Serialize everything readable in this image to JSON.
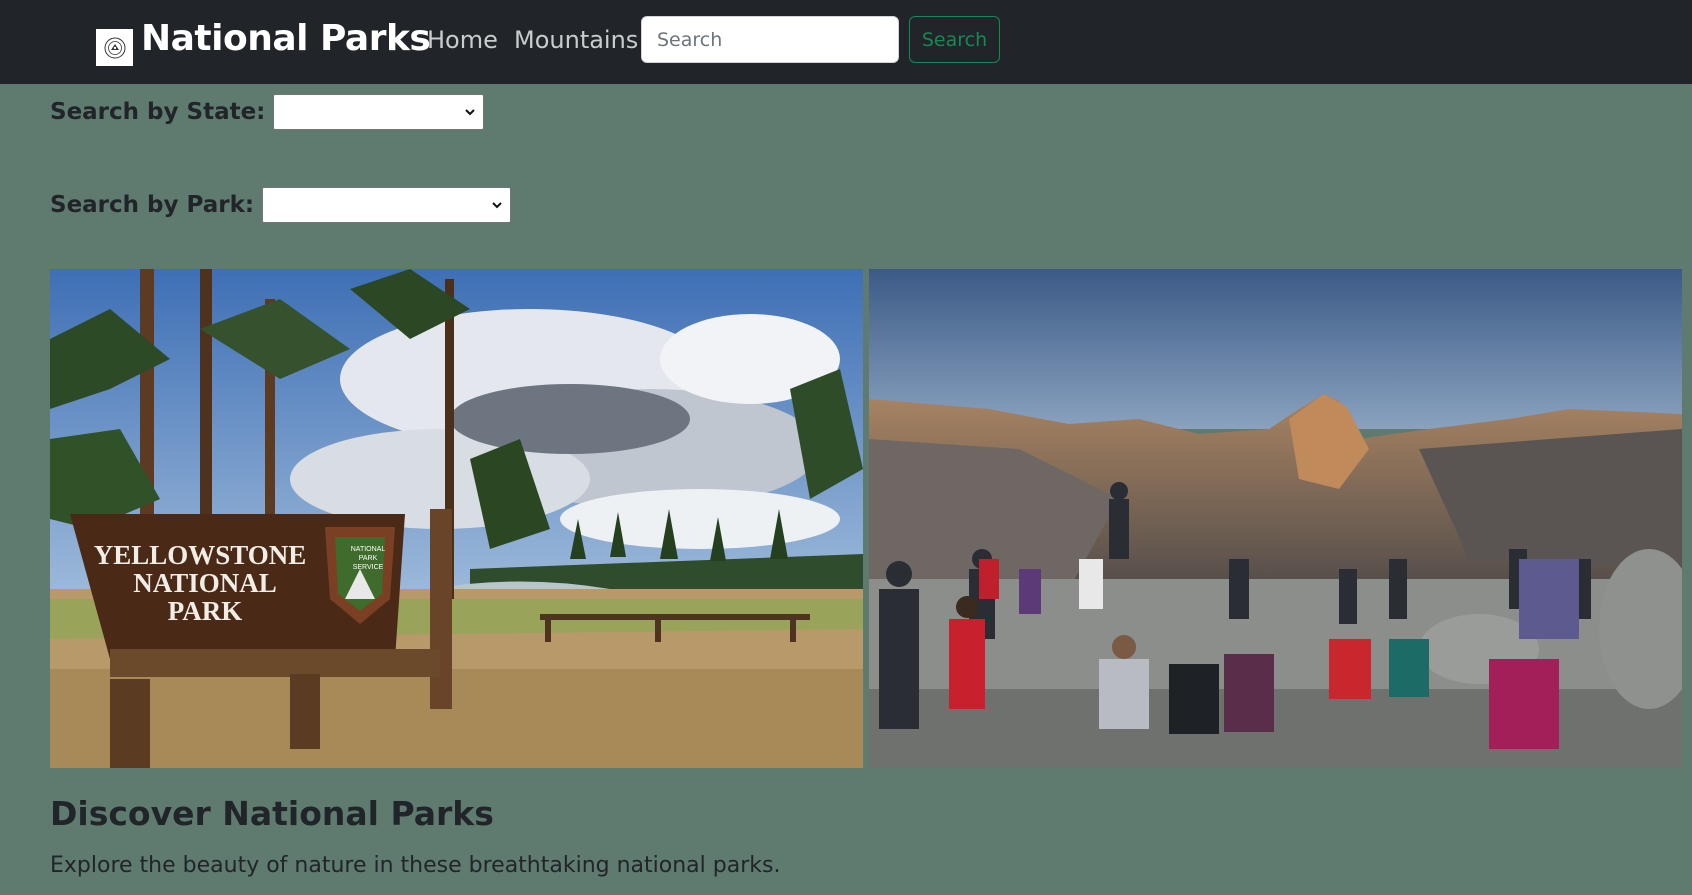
{
  "navbar": {
    "brand_name": "National Parks",
    "links": [
      "Home",
      "Mountains"
    ],
    "search_placeholder": "Search",
    "search_button_label": "Search"
  },
  "filters": {
    "state_label": "Search by State:",
    "state_value": "",
    "park_label": "Search by Park:",
    "park_value": ""
  },
  "images": [
    {
      "name": "yellowstone-sign-photo",
      "sign_lines": [
        "YELLOWSTONE",
        "NATIONAL",
        "PARK"
      ],
      "badge_lines": [
        "NATIONAL",
        "PARK",
        "SERVICE"
      ]
    },
    {
      "name": "yosemite-overlook-photo"
    }
  ],
  "main": {
    "heading": "Discover National Parks",
    "subtext": "Explore the beauty of nature in these breathtaking national parks."
  },
  "colors": {
    "page_background": "#5f7b70",
    "navbar_background": "#212529",
    "accent_green": "#198754"
  }
}
